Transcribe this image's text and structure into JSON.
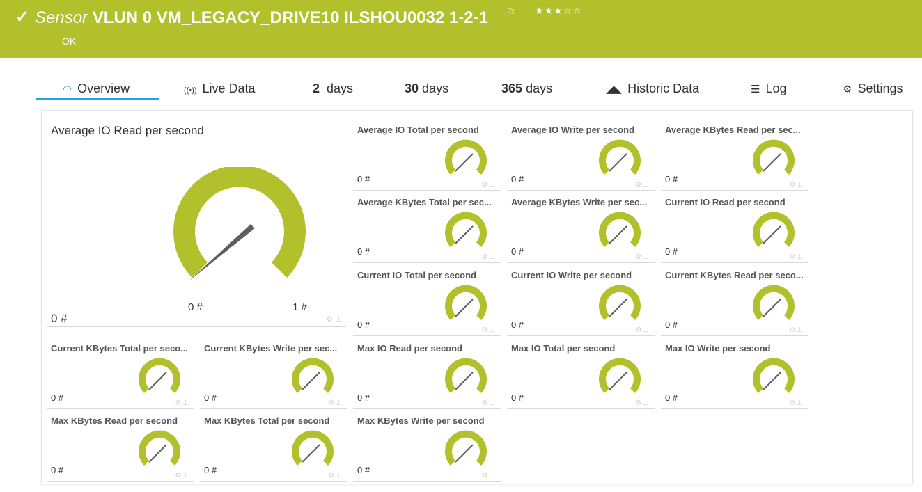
{
  "header": {
    "check_icon": "check-icon",
    "kind": "Sensor",
    "name": "VLUN 0 VM_LEGACY_DRIVE10 ILSHOU0032 1-2-1",
    "flag_icon": "flag-icon",
    "stars": "★★★☆☆",
    "rating": 3,
    "status": "OK",
    "color": "#b2c02b"
  },
  "tabs": [
    {
      "icon": "gauge-icon",
      "glyph": "◠",
      "prefix": "",
      "label": "Overview",
      "active": true
    },
    {
      "icon": "live-signal-icon",
      "glyph": "((•))",
      "prefix": "",
      "label": "Live Data"
    },
    {
      "icon": "",
      "glyph": "",
      "prefix": "2",
      "label": "days"
    },
    {
      "icon": "",
      "glyph": "",
      "prefix": "30",
      "label": "days"
    },
    {
      "icon": "",
      "glyph": "",
      "prefix": "365",
      "label": "days"
    },
    {
      "icon": "area-chart-icon",
      "glyph": "▲",
      "prefix": "",
      "label": "Historic Data"
    },
    {
      "icon": "log-icon",
      "glyph": "☰",
      "prefix": "",
      "label": "Log"
    },
    {
      "icon": "gear-icon",
      "glyph": "⚙",
      "prefix": "",
      "label": "Settings"
    }
  ],
  "main_gauge": {
    "title": "Average IO Read per second",
    "value": "0 #",
    "min": "0 #",
    "max": "1 #",
    "level": 0,
    "color": "#b2c02b"
  },
  "gauges": [
    {
      "title": "Average IO Total per second",
      "value": "0 #"
    },
    {
      "title": "Average IO Write per second",
      "value": "0 #"
    },
    {
      "title": "Average KBytes Read per sec...",
      "value": "0 #"
    },
    {
      "title": "Average KBytes Total per sec...",
      "value": "0 #"
    },
    {
      "title": "Average KBytes Write per sec...",
      "value": "0 #"
    },
    {
      "title": "Current IO Read per second",
      "value": "0 #"
    },
    {
      "title": "Current IO Total per second",
      "value": "0 #"
    },
    {
      "title": "Current IO Write per second",
      "value": "0 #"
    },
    {
      "title": "Current KBytes Read per seco...",
      "value": "0 #"
    },
    {
      "title": "Current KBytes Total per seco...",
      "value": "0 #"
    },
    {
      "title": "Current KBytes Write per sec...",
      "value": "0 #"
    },
    {
      "title": "Max IO Read per second",
      "value": "0 #"
    },
    {
      "title": "Max IO Total per second",
      "value": "0 #"
    },
    {
      "title": "Max IO Write per second",
      "value": "0 #"
    },
    {
      "title": "Max KBytes Read per second",
      "value": "0 #"
    },
    {
      "title": "Max KBytes Total per second",
      "value": "0 #"
    },
    {
      "title": "Max KBytes Write per second",
      "value": "0 #"
    }
  ]
}
